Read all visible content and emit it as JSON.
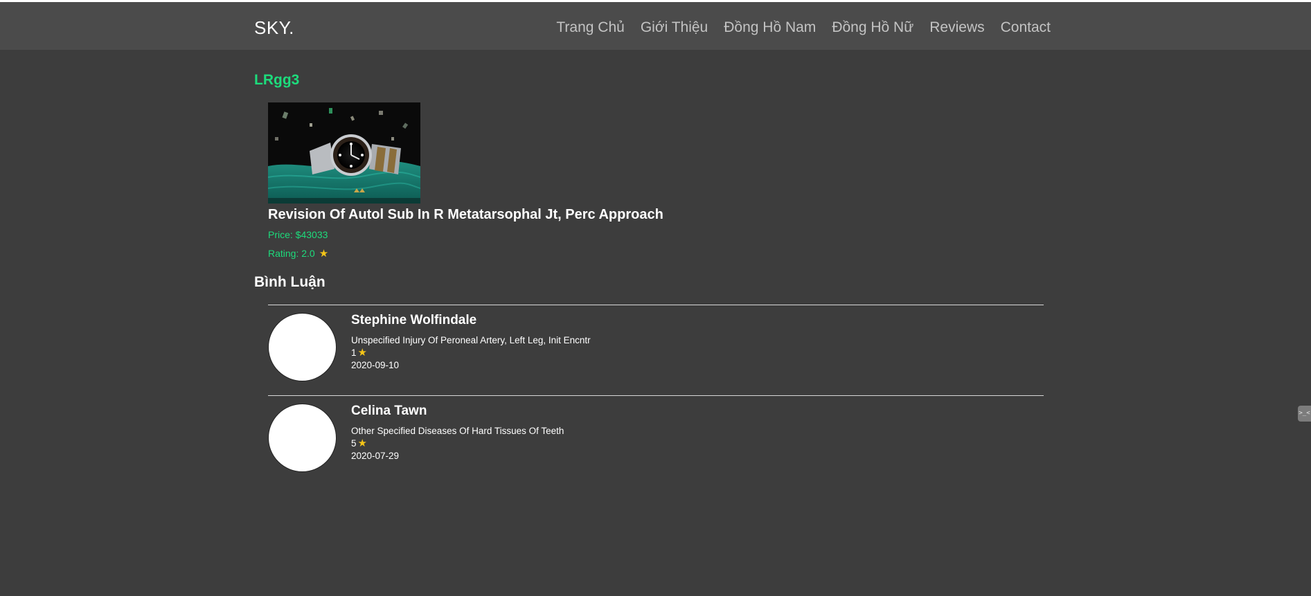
{
  "header": {
    "brand": "SKY.",
    "nav": [
      {
        "label": "Trang Chủ"
      },
      {
        "label": "Giới Thiệu"
      },
      {
        "label": "Đồng Hồ Nam"
      },
      {
        "label": "Đồng Hồ Nữ"
      },
      {
        "label": "Reviews"
      },
      {
        "label": "Contact"
      }
    ]
  },
  "product": {
    "code": "LRgg3",
    "name": "Revision Of Autol Sub In R Metatarsophal Jt, Perc Approach",
    "price": "Price: $43033",
    "rating": "Rating: 2.0",
    "image_icon": "watch-photo"
  },
  "comments_section": {
    "title": "Bình Luận",
    "items": [
      {
        "name": "Stephine Wolfindale",
        "text": "Unspecified Injury Of Peroneal Artery, Left Leg, Init Encntr",
        "rating": "1",
        "date": "2020-09-10"
      },
      {
        "name": "Celina Tawn",
        "text": "Other Specified Diseases Of Hard Tissues Of Teeth",
        "rating": "5",
        "date": "2020-07-29"
      }
    ]
  },
  "side_tab": {
    "icon": "terminal-icon",
    "label": ">_<"
  },
  "colors": {
    "background": "#3d3d3d",
    "navbar": "#4b4b4b",
    "accent": "#1ddc7c",
    "star": "#f5c518"
  }
}
